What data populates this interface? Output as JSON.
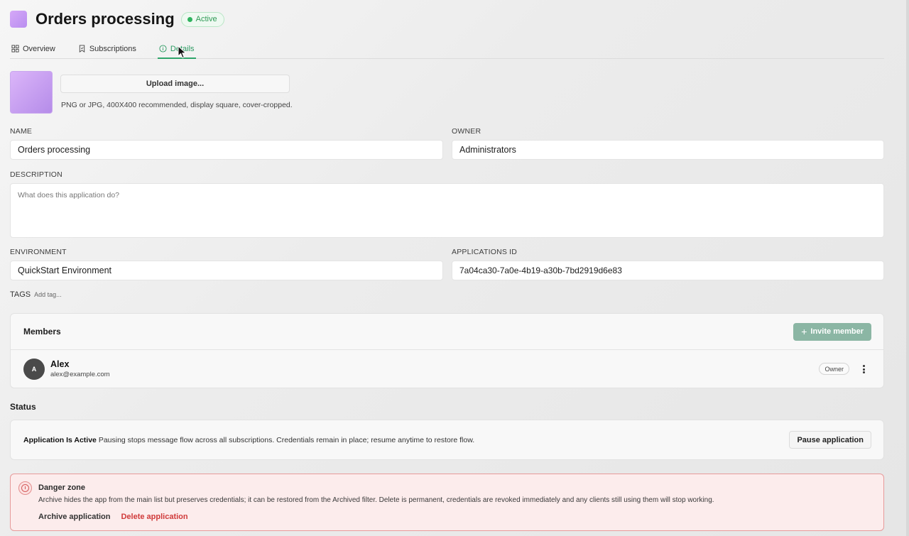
{
  "header": {
    "title": "Orders processing",
    "status_badge": "Active",
    "accent_color": "#2fa56a"
  },
  "tabs": [
    {
      "label": "Overview",
      "icon": "grid-icon",
      "active": false
    },
    {
      "label": "Subscriptions",
      "icon": "bookmark-icon",
      "active": false
    },
    {
      "label": "Details",
      "icon": "info-icon",
      "active": true
    }
  ],
  "image_upload": {
    "button_label": "Upload image...",
    "hint": "PNG or JPG, 400X400 recommended, display square, cover-cropped."
  },
  "form": {
    "name_label": "NAME",
    "name_value": "Orders processing",
    "owner_label": "OWNER",
    "owner_value": "Administrators",
    "description_label": "DESCRIPTION",
    "description_placeholder": "What does this application do?",
    "environment_label": "ENVIRONMENT",
    "environment_value": "QuickStart Environment",
    "app_id_label": "APPLICATIONS ID",
    "app_id_value": "7a04ca30-7a0e-4b19-a30b-7bd2919d6e83",
    "tags_label": "TAGS",
    "tags_add": "Add tag..."
  },
  "members": {
    "title": "Members",
    "invite_label": "Invite member",
    "list": [
      {
        "initial": "A",
        "name": "Alex",
        "email": "alex@example.com",
        "role": "Owner"
      }
    ]
  },
  "status": {
    "title": "Status",
    "heading": "Application Is Active",
    "description": "Pausing stops message flow across all subscriptions. Credentials remain in place; resume anytime to restore flow.",
    "pause_label": "Pause application"
  },
  "danger_zone": {
    "title": "Danger zone",
    "description": "Archive hides the app from the main list but preserves credentials; it can be restored from the Archived filter. Delete is permanent, credentials are revoked immediately and any clients still using them will stop working.",
    "archive_label": "Archive application",
    "delete_label": "Delete application",
    "danger_color": "#d03a3a"
  }
}
